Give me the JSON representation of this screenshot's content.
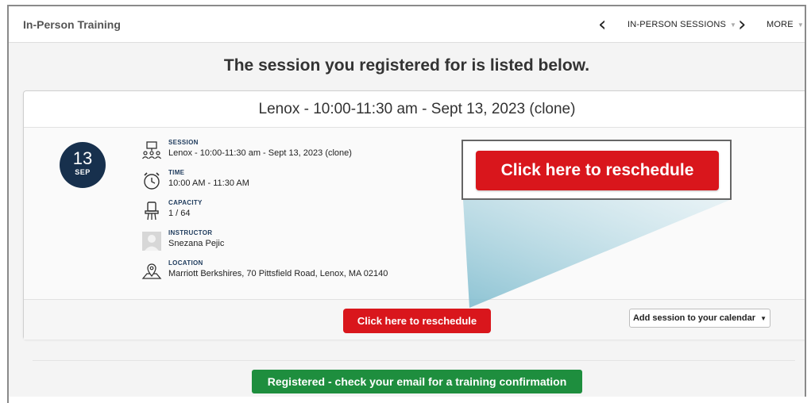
{
  "header": {
    "title": "In-Person Training",
    "nav_label": "IN-PERSON SESSIONS",
    "more_label": "MORE"
  },
  "heading": "The session you registered for is listed below.",
  "session": {
    "title": "Lenox - 10:00-11:30 am - Sept 13, 2023 (clone)",
    "date_day": "13",
    "date_month": "SEP",
    "details": [
      {
        "label": "SESSION",
        "value": "Lenox - 10:00-11:30 am - Sept 13, 2023 (clone)",
        "icon": "classroom-icon"
      },
      {
        "label": "TIME",
        "value": "10:00 AM - 11:30 AM",
        "icon": "alarm-clock-icon"
      },
      {
        "label": "CAPACITY",
        "value": "1 / 64",
        "icon": "seat-icon"
      },
      {
        "label": "INSTRUCTOR",
        "value": "Snezana Pejic",
        "icon": "avatar-placeholder-icon"
      },
      {
        "label": "LOCATION",
        "value": "Marriott Berkshires, 70 Pittsfield Road, Lenox, MA 02140",
        "icon": "map-pin-icon"
      }
    ]
  },
  "buttons": {
    "reschedule": "Click here to reschedule",
    "reschedule_zoom": "Click here to reschedule",
    "calendar": "Add session to your calendar",
    "registered": "Registered - check your email for a training confirmation"
  },
  "colors": {
    "accent_red": "#d9161c",
    "badge_navy": "#17304d",
    "success_green": "#1e8e3e"
  }
}
